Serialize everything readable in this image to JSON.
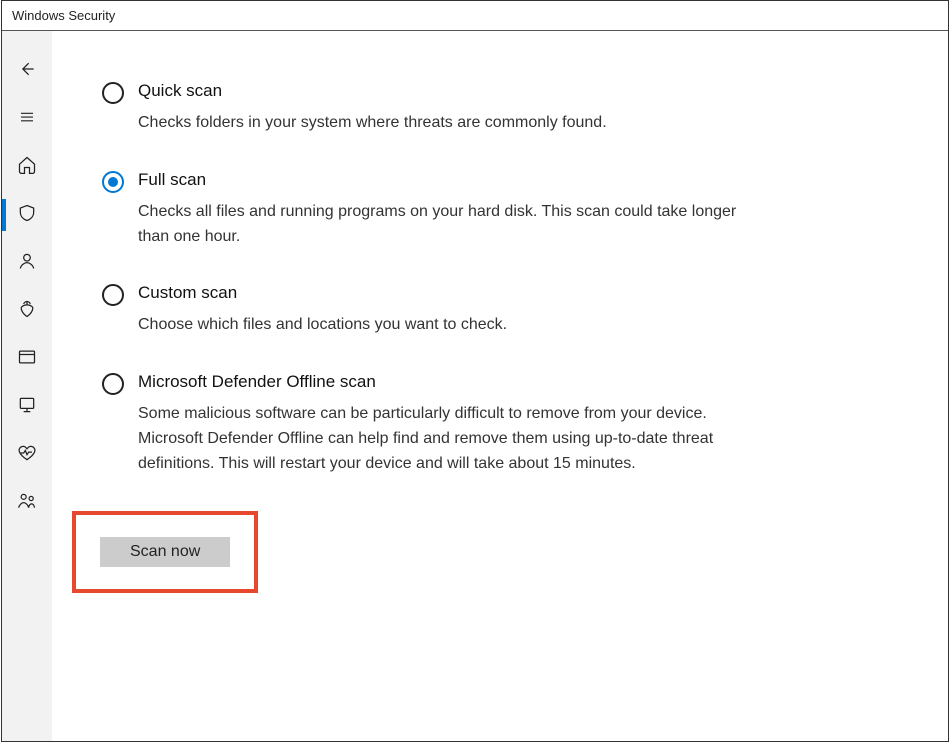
{
  "window": {
    "title": "Windows Security"
  },
  "sidebar": {
    "items": [
      {
        "name": "back",
        "selected": false
      },
      {
        "name": "menu",
        "selected": false
      },
      {
        "name": "home",
        "selected": false
      },
      {
        "name": "shield",
        "selected": true
      },
      {
        "name": "account",
        "selected": false
      },
      {
        "name": "firewall",
        "selected": false
      },
      {
        "name": "app",
        "selected": false
      },
      {
        "name": "device",
        "selected": false
      },
      {
        "name": "health",
        "selected": false
      },
      {
        "name": "family",
        "selected": false
      }
    ]
  },
  "scan": {
    "options": [
      {
        "title": "Quick scan",
        "desc": "Checks folders in your system where threats are commonly found.",
        "checked": false
      },
      {
        "title": "Full scan",
        "desc": "Checks all files and running programs on your hard disk. This scan could take longer than one hour.",
        "checked": true
      },
      {
        "title": "Custom scan",
        "desc": "Choose which files and locations you want to check.",
        "checked": false
      },
      {
        "title": "Microsoft Defender Offline scan",
        "desc": "Some malicious software can be particularly difficult to remove from your device. Microsoft Defender Offline can help find and remove them using up-to-date threat definitions. This will restart your device and will take about 15 minutes.",
        "checked": false
      }
    ],
    "button_label": "Scan now"
  }
}
